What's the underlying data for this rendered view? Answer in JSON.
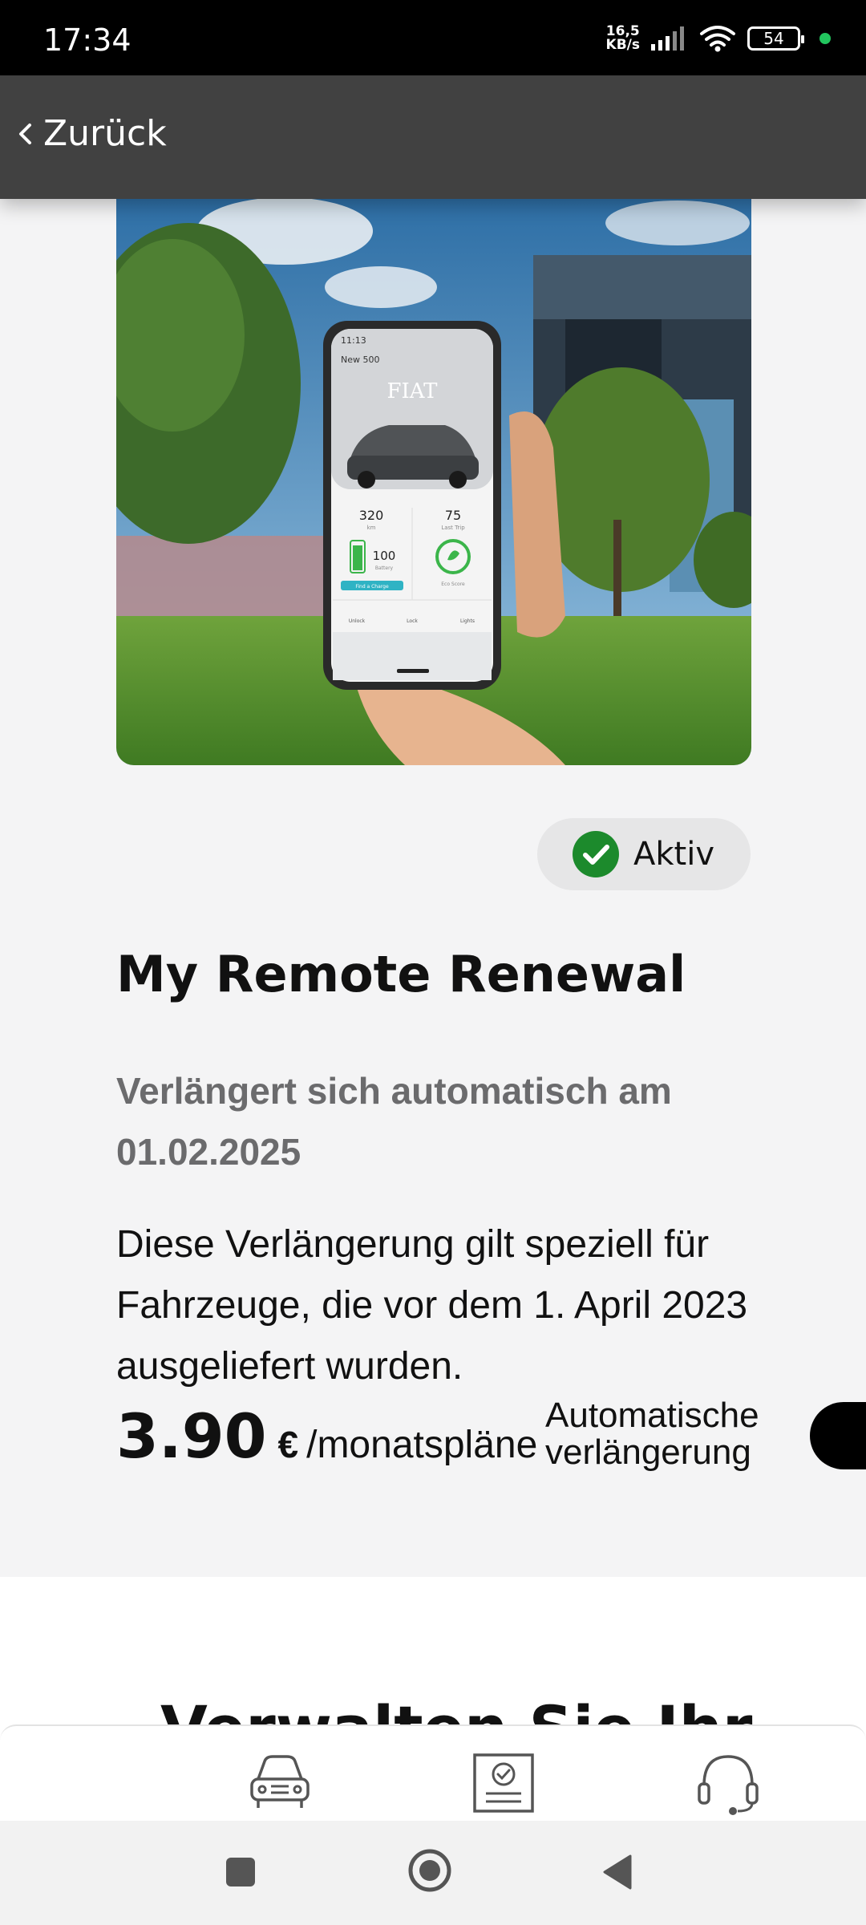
{
  "status_bar": {
    "time": "17:34",
    "net_speed_value": "16,5",
    "net_speed_unit": "KB/s",
    "battery": "54",
    "icons": [
      "signal-icon",
      "wifi-icon",
      "battery-icon"
    ]
  },
  "header": {
    "back_label": "Zurück",
    "icon": "chevron-left-icon"
  },
  "hero": {
    "phone": {
      "time": "11:13",
      "model": "New 500",
      "brand": "FIAT",
      "stat1_value": "320",
      "stat1_label": "km",
      "stat2_value": "75",
      "stat2_label": "Last Trip",
      "battery_value": "100",
      "battery_label": "Battery",
      "eco_label": "Eco Score",
      "find_charge": "Find a Charge",
      "actions": [
        "Unlock",
        "Lock",
        "Lights"
      ]
    }
  },
  "plan": {
    "status_label": "Aktiv",
    "status_color": "#1c8a2c",
    "title": "My Remote Renewal",
    "renewal_text": "Verlängert sich automatisch am 01.02.2025",
    "description": "Diese Verlängerung gilt speziell für Fahrzeuge, die vor dem 1. April 2023 ausgeliefert wurden.",
    "price": "3.90",
    "currency": "€",
    "period": "/monatspläne",
    "auto_renew_label": "Automatische verlängerung",
    "auto_renew_enabled": true
  },
  "next_section": {
    "heading_partial": "Verwalten Sie Ihr"
  },
  "bottom_nav": {
    "items": [
      {
        "icon": "car-icon"
      },
      {
        "icon": "subscription-document-icon"
      },
      {
        "icon": "headset-support-icon"
      }
    ]
  },
  "system_nav": {
    "icons": [
      "recents-square-icon",
      "home-circle-icon",
      "back-triangle-icon"
    ]
  }
}
